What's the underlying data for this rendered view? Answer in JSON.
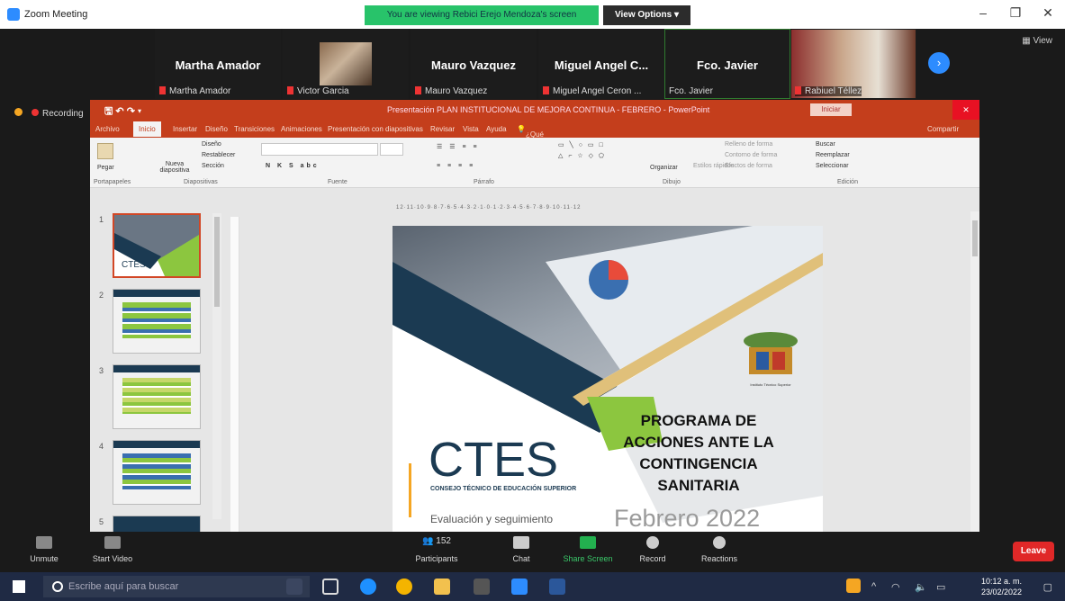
{
  "window": {
    "title": "Zoom Meeting",
    "viewing": "You are viewing Rebici Erejo Mendoza's screen",
    "view_options": "View Options"
  },
  "participants": [
    {
      "big": "Martha Amador",
      "small": "Martha Amador"
    },
    {
      "big": "",
      "small": "Victor Garcia"
    },
    {
      "big": "Mauro Vazquez",
      "small": "Mauro Vazquez"
    },
    {
      "big": "Miguel Angel C...",
      "small": "Miguel Angel Ceron ..."
    },
    {
      "big": "Fco. Javier",
      "small": "Fco. Javier"
    },
    {
      "big": "",
      "small": "Rabiuel Téllez"
    }
  ],
  "view_label": "View",
  "recording_label": "Recording",
  "ppt": {
    "title": "Presentación PLAN INSTITUCIONAL DE MEJORA CONTINUA - FEBRERO - PowerPoint",
    "sign_in": "Iniciar sesión",
    "tabs": [
      "Archivo",
      "Inicio",
      "Insertar",
      "Diseño",
      "Transiciones",
      "Animaciones",
      "Presentación con diapositivas",
      "Revisar",
      "Vista",
      "Ayuda",
      "¿Qué desea hacer?",
      "Compartir"
    ],
    "groups": [
      "Portapapeles",
      "Diapositivas",
      "Fuente",
      "Párrafo",
      "Dibujo",
      "Edición"
    ],
    "items": {
      "paste": "Pegar",
      "new_slide": "Nueva diapositiva",
      "layout": "Diseño",
      "reset": "Restablecer",
      "section": "Sección",
      "find": "Buscar",
      "replace": "Reemplazar",
      "select": "Seleccionar",
      "arrange": "Organizar",
      "styles": "Estilos rápidos",
      "fill": "Relleno de forma",
      "outline": "Contorno de forma",
      "effects": "Efectos de forma"
    },
    "slide_numbers": [
      "1",
      "2",
      "3",
      "4",
      "5"
    ],
    "ruler": "12·11·10·9·8·7·6·5·4·3·2·1·0·1·2·3·4·5·6·7·8·9·10·11·12"
  },
  "slide": {
    "brand": "CTES",
    "brand_sub": "CONSEJO TÉCNICO DE EDUCACIÓN SUPERIOR",
    "title_lines": [
      "PROGRAMA DE",
      "ACCIONES ANTE LA",
      "CONTINGENCIA",
      "SANITARIA"
    ],
    "eval": "Evaluación y seguimiento",
    "date": "Febrero 2022",
    "logo_caption": "Instituto Técnico Superior",
    "thumb_brand": "CTES"
  },
  "controls": {
    "unmute": "Unmute",
    "start_video": "Start Video",
    "participants": "Participants",
    "participants_count": "152",
    "chat": "Chat",
    "share": "Share Screen",
    "record": "Record",
    "reactions": "Reactions",
    "leave": "Leave"
  },
  "taskbar": {
    "search": "Escribe aquí para buscar",
    "time": "10:12 a. m.",
    "date": "23/02/2022"
  }
}
